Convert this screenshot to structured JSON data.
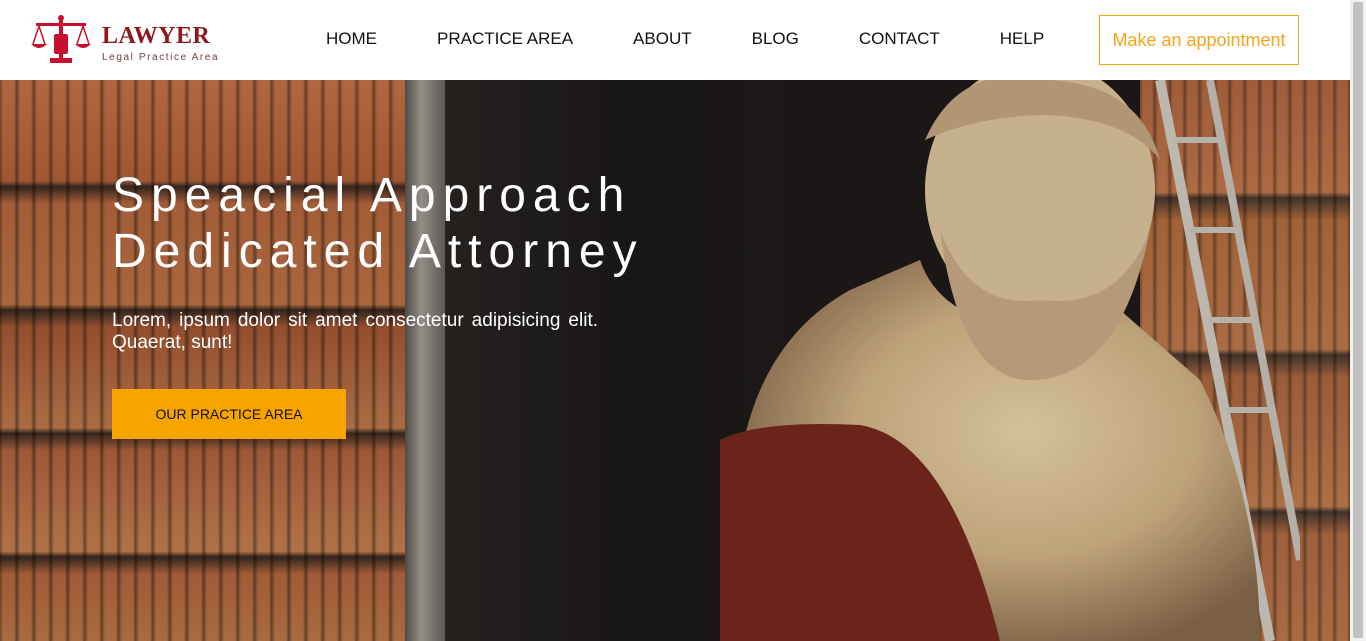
{
  "brand": {
    "name": "LAWYER",
    "tagline": "Legal Practice Area",
    "logo_icon": "scales-of-justice-icon",
    "color": "#c8102e"
  },
  "nav": {
    "items": [
      "HOME",
      "PRACTICE AREA",
      "ABOUT",
      "BLOG",
      "CONTACT",
      "HELP"
    ]
  },
  "header": {
    "appointment_label": "Make an appointment",
    "accent_color": "#f5a31a"
  },
  "hero": {
    "title_line1": "Speacial Approach",
    "title_line2": "Dedicated Attorney",
    "subtitle": "Lorem, ipsum dolor sit amet consectetur adipisicing elit. Quaerat, sunt!",
    "cta_label": "OUR PRACTICE AREA",
    "cta_color": "#f7a300",
    "background": "library-bookshelves-with-marble-bust"
  }
}
